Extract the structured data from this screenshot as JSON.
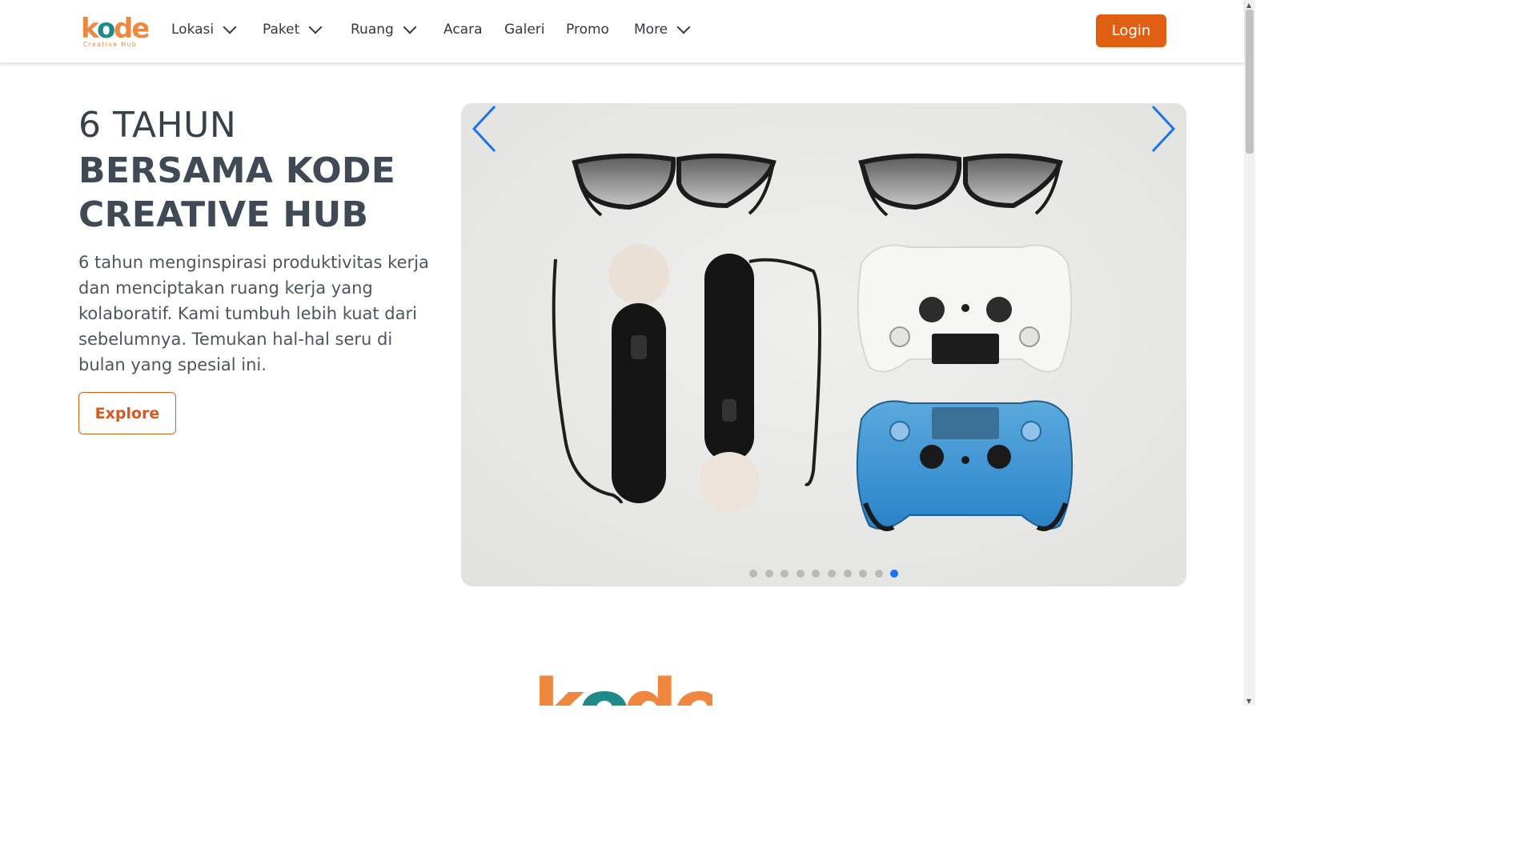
{
  "brand": {
    "logo_text": "kode",
    "logo_sub": "Creative Hub",
    "colors": {
      "orange": "#f0873f",
      "teal": "#1f8a8a",
      "accent": "#e15f13"
    }
  },
  "nav": {
    "items": [
      {
        "label": "Lokasi",
        "has_dropdown": true
      },
      {
        "label": "Paket",
        "has_dropdown": true
      },
      {
        "label": "Ruang",
        "has_dropdown": true
      },
      {
        "label": "Acara",
        "has_dropdown": false
      },
      {
        "label": "Galeri",
        "has_dropdown": false
      },
      {
        "label": "Promo",
        "has_dropdown": false
      },
      {
        "label": "More",
        "has_dropdown": true
      }
    ],
    "login_label": "Login"
  },
  "hero": {
    "title_light": "6 TAHUN",
    "title_bold": "BERSAMA KODE CREATIVE HUB",
    "description": "6 tahun menginspirasi produktivitas kerja dan menciptakan ruang kerja yang kolaboratif. Kami tumbuh lebih kuat dari sebelumnya. Temukan hal-hal seru di bulan yang spesial ini.",
    "cta_label": "Explore"
  },
  "carousel": {
    "slide_count": 10,
    "active_index": 9,
    "prev_icon": "chevron-left-icon",
    "next_icon": "chevron-right-icon",
    "arrow_color": "#1a73e8"
  }
}
